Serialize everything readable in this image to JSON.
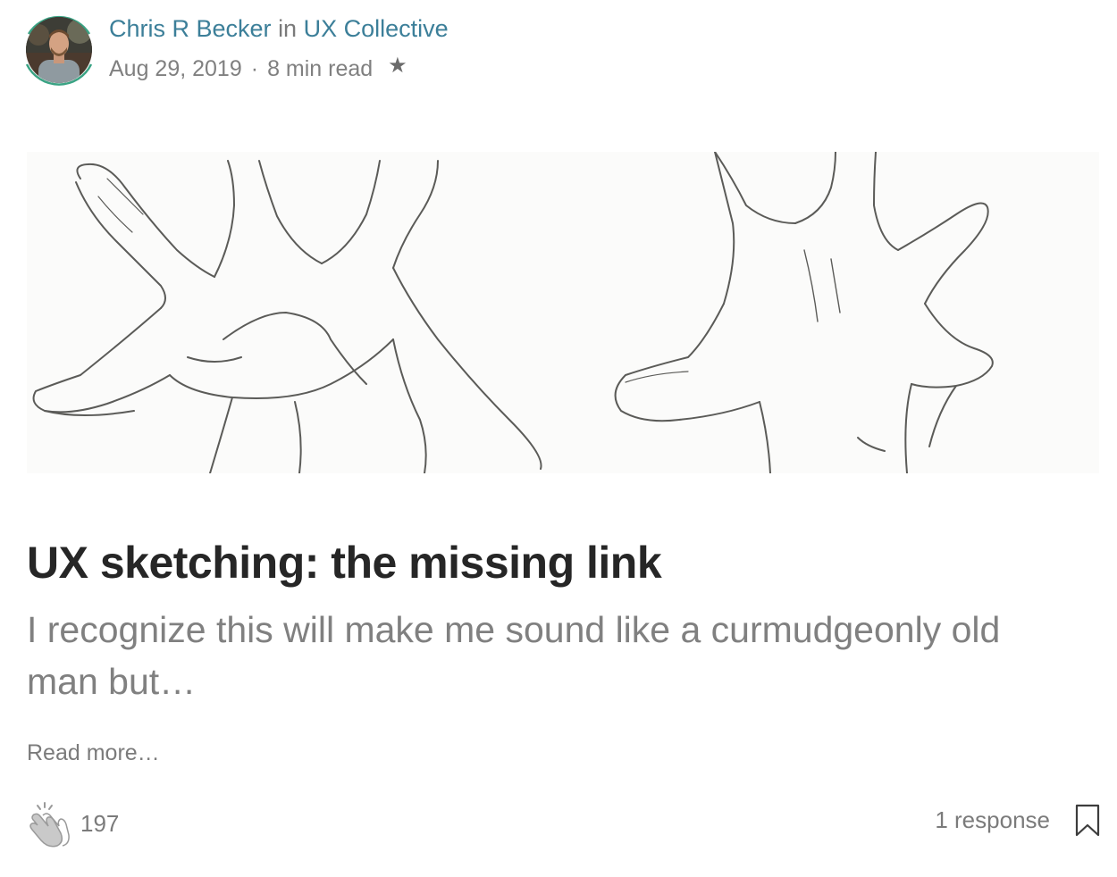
{
  "author": {
    "name": "Chris R Becker",
    "connector": "in",
    "publication": "UX Collective",
    "avatar_icon": "author-avatar"
  },
  "meta": {
    "date": "Aug 29, 2019",
    "separator": "·",
    "read_time": "8 min read",
    "member_icon": "star-icon"
  },
  "hero_image": {
    "description_icon": "hands-sketch-image"
  },
  "article": {
    "title": "UX sketching: the missing link",
    "excerpt": "I recognize this will make me sound like a curmudgeonly old man but…",
    "read_more": "Read more…"
  },
  "footer": {
    "clap_icon": "clap-icon",
    "clap_count": "197",
    "responses": "1 response",
    "bookmark_icon": "bookmark-icon"
  },
  "colors": {
    "accent": "#3c7f99",
    "ring": "#3aa384",
    "meta_text": "#808080",
    "title_text": "#262626"
  }
}
